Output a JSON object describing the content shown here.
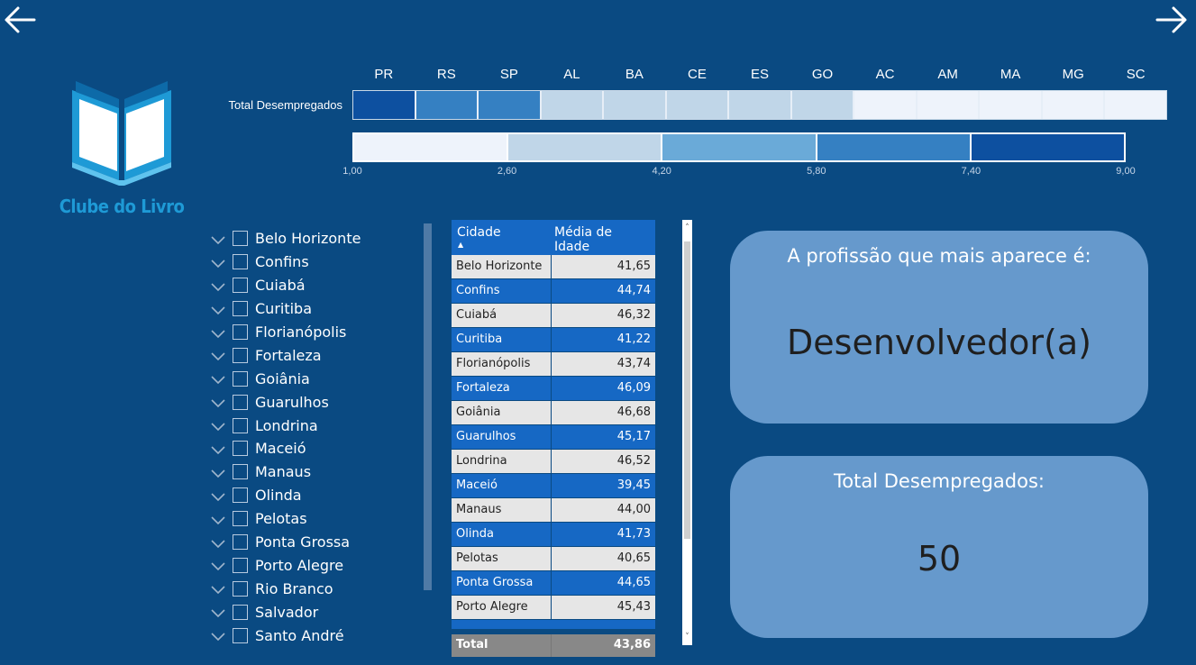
{
  "colors": {
    "background": "#0a4a82",
    "accent_blue": "#1668c4",
    "card": "#6699cc",
    "logo": "#1e9ad6"
  },
  "nav": {
    "back_icon": "arrow-left-icon",
    "forward_icon": "arrow-right-icon"
  },
  "logo": {
    "text": "Clube do Livro",
    "icon": "open-book-icon"
  },
  "heatmap": {
    "row_label": "Total Desempregados",
    "states": [
      "PR",
      "RS",
      "SP",
      "AL",
      "BA",
      "CE",
      "ES",
      "GO",
      "AC",
      "AM",
      "MA",
      "MG",
      "SC"
    ],
    "colors": [
      "#0d50a0",
      "#3580c2",
      "#3580c2",
      "#c0d6e8",
      "#c0d6e8",
      "#c0d6e8",
      "#c0d6e8",
      "#c0d6e8",
      "#eef3fb",
      "#eef3fb",
      "#eef3fb",
      "#eef3fb",
      "#eef3fb"
    ],
    "legend_colors": [
      "#eef3fb",
      "#c0d6e8",
      "#6aaad8",
      "#3580c2",
      "#0d50a0"
    ],
    "legend_ticks": [
      "1,00",
      "2,60",
      "4,20",
      "5,80",
      "7,40",
      "9,00"
    ]
  },
  "slicer": {
    "items": [
      "Belo Horizonte",
      "Confins",
      "Cuiabá",
      "Curitiba",
      "Florianópolis",
      "Fortaleza",
      "Goiânia",
      "Guarulhos",
      "Londrina",
      "Maceió",
      "Manaus",
      "Olinda",
      "Pelotas",
      "Ponta Grossa",
      "Porto Alegre",
      "Rio Branco",
      "Salvador",
      "Santo André"
    ]
  },
  "table": {
    "col_city": "Cidade",
    "col_age": "Média de Idade",
    "rows": [
      {
        "city": "Belo Horizonte",
        "age": "41,65"
      },
      {
        "city": "Confins",
        "age": "44,74"
      },
      {
        "city": "Cuiabá",
        "age": "46,32"
      },
      {
        "city": "Curitiba",
        "age": "41,22"
      },
      {
        "city": "Florianópolis",
        "age": "43,74"
      },
      {
        "city": "Fortaleza",
        "age": "46,09"
      },
      {
        "city": "Goiânia",
        "age": "46,68"
      },
      {
        "city": "Guarulhos",
        "age": "45,17"
      },
      {
        "city": "Londrina",
        "age": "46,52"
      },
      {
        "city": "Maceió",
        "age": "39,45"
      },
      {
        "city": "Manaus",
        "age": "44,00"
      },
      {
        "city": "Olinda",
        "age": "41,73"
      },
      {
        "city": "Pelotas",
        "age": "40,65"
      },
      {
        "city": "Ponta Grossa",
        "age": "44,65"
      },
      {
        "city": "Porto Alegre",
        "age": "45,43"
      }
    ],
    "total_label": "Total",
    "total_value": "43,86"
  },
  "cards": {
    "profession_title": "A profissão que mais aparece é:",
    "profession_value": "Desenvolvedor(a)",
    "unemployed_title": "Total Desempregados:",
    "unemployed_value": "50"
  }
}
